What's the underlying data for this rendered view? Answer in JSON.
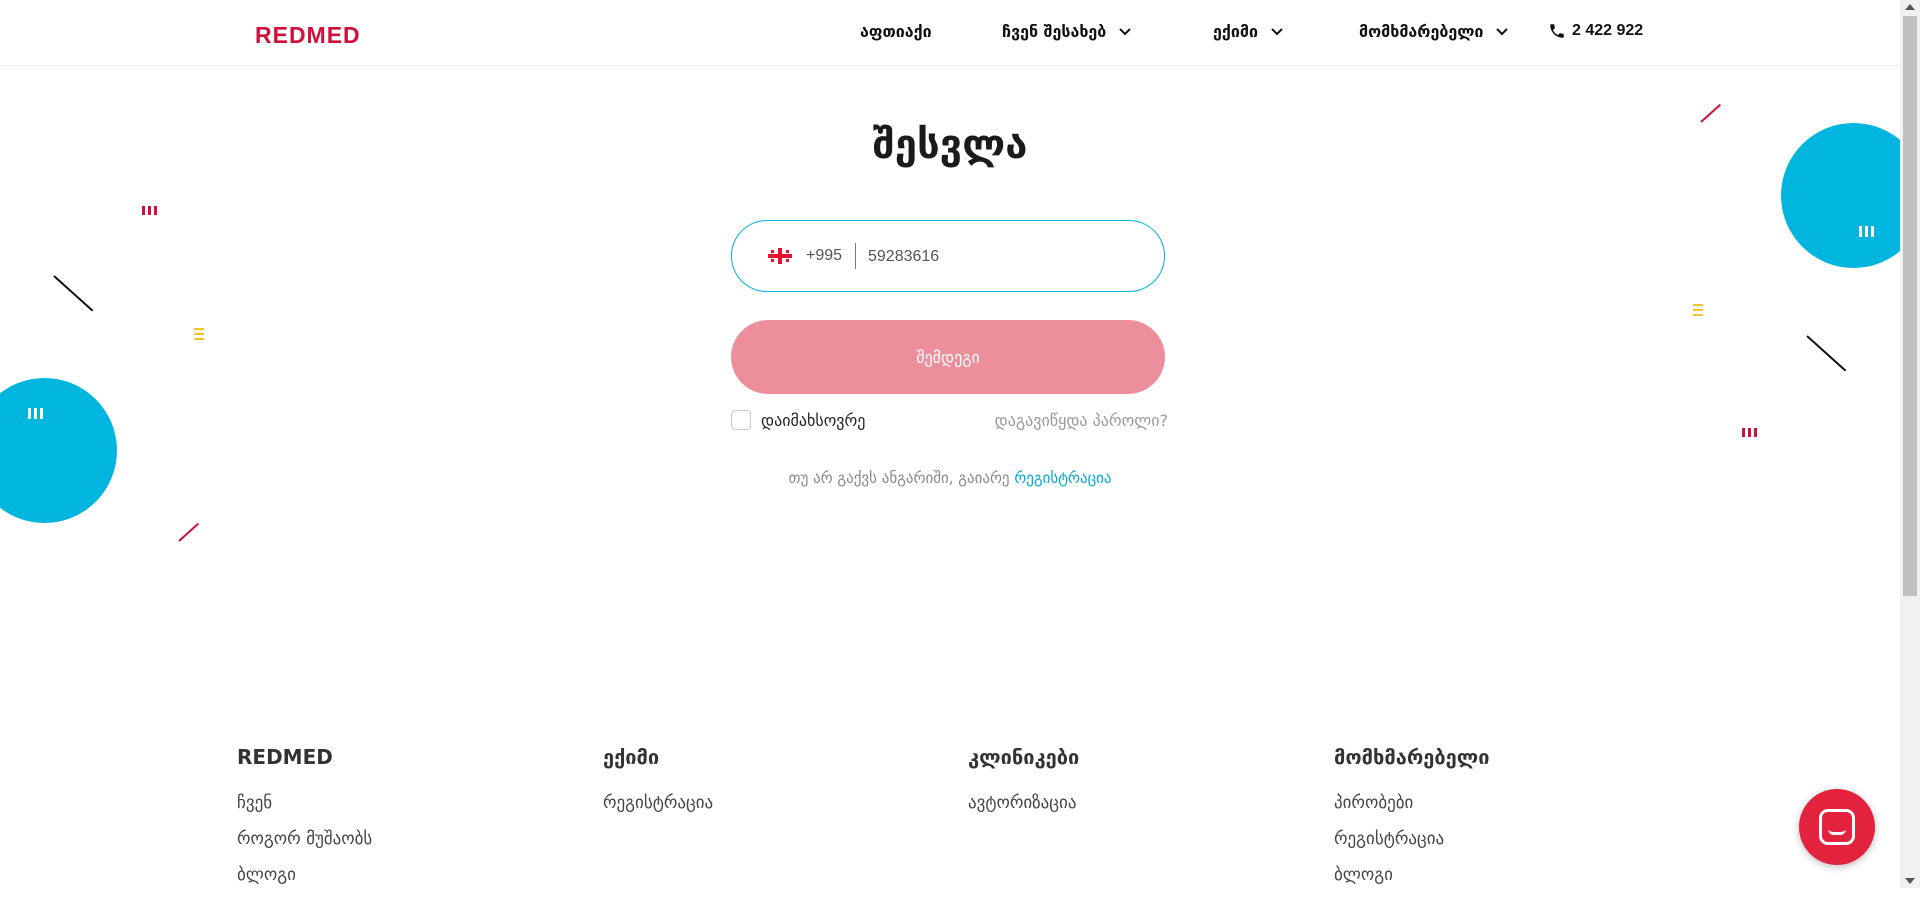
{
  "header": {
    "logo": "REDMED",
    "nav": [
      {
        "label": "აფთიაქი",
        "has_dropdown": false
      },
      {
        "label": "ჩვენ შესახებ",
        "has_dropdown": true
      },
      {
        "label": "ექიმი",
        "has_dropdown": true
      },
      {
        "label": "მომხმარებელი",
        "has_dropdown": true
      }
    ],
    "phone": "2 422 922"
  },
  "login": {
    "title": "შესვლა",
    "country_code": "+995",
    "phone_value": "59283616",
    "next_button": "შემდეგი",
    "remember_label": "დაიმახსოვრე",
    "remember_checked": false,
    "forgot_password": "დაგავიწყდა პაროლი?",
    "register_prompt": "თუ არ გაქვს ანგარიში, გაიარე",
    "register_link": "რეგისტრაცია"
  },
  "footer": {
    "columns": [
      {
        "title": "REDMED",
        "links": [
          "ჩვენ",
          "როგორ მუშაობს",
          "ბლოგი"
        ]
      },
      {
        "title": "ექიმი",
        "links": [
          "რეგისტრაცია"
        ]
      },
      {
        "title": "კლინიკები",
        "links": [
          "ავტორიზაცია"
        ]
      },
      {
        "title": "მომხმარებელი",
        "links": [
          "პირობები",
          "რეგისტრაცია",
          "ბლოგი"
        ]
      }
    ]
  },
  "colors": {
    "brand_red": "#d0103a",
    "accent_cyan": "#00b6de",
    "button_pink": "#ed8e9d",
    "yellow": "#f4c12e"
  },
  "icons": [
    "phone-icon",
    "chevron-down-icon",
    "georgia-flag-icon",
    "chat-icon"
  ]
}
